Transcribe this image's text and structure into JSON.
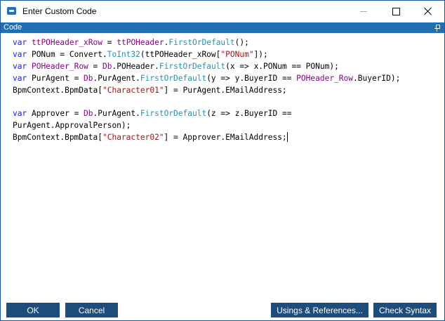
{
  "window": {
    "title": "Enter Custom Code",
    "icon": "app-icon"
  },
  "panel": {
    "title": "Code",
    "pin_icon": "pin-icon"
  },
  "code": {
    "lines": [
      [
        [
          "kw",
          "var"
        ],
        [
          "pl",
          " "
        ],
        [
          "var",
          "ttPOHeader_xRow"
        ],
        [
          "pl",
          " = "
        ],
        [
          "var",
          "ttPOHeader"
        ],
        [
          "pl",
          "."
        ],
        [
          "ty",
          "FirstOrDefault"
        ],
        [
          "pl",
          "();"
        ]
      ],
      [
        [
          "kw",
          "var"
        ],
        [
          "pl",
          " PONum = Convert."
        ],
        [
          "ty",
          "ToInt32"
        ],
        [
          "pl",
          "(ttPOHeader_xRow["
        ],
        [
          "str",
          "\"PONum\""
        ],
        [
          "pl",
          "]);"
        ]
      ],
      [
        [
          "kw",
          "var"
        ],
        [
          "pl",
          " "
        ],
        [
          "var",
          "POHeader_Row"
        ],
        [
          "pl",
          " = "
        ],
        [
          "var",
          "Db"
        ],
        [
          "pl",
          ".POHeader."
        ],
        [
          "ty",
          "FirstOrDefault"
        ],
        [
          "pl",
          "(x => x.PONum == PONum);"
        ]
      ],
      [
        [
          "kw",
          "var"
        ],
        [
          "pl",
          " PurAgent = "
        ],
        [
          "var",
          "Db"
        ],
        [
          "pl",
          ".PurAgent."
        ],
        [
          "ty",
          "FirstOrDefault"
        ],
        [
          "pl",
          "(y => y.BuyerID == "
        ],
        [
          "var",
          "POHeader_Row"
        ],
        [
          "pl",
          ".BuyerID);"
        ]
      ],
      [
        [
          "pl",
          "BpmContext.BpmData["
        ],
        [
          "str",
          "\"Character01\""
        ],
        [
          "pl",
          "] = PurAgent.EMailAddress;"
        ]
      ],
      [],
      [
        [
          "kw",
          "var"
        ],
        [
          "pl",
          " Approver = "
        ],
        [
          "var",
          "Db"
        ],
        [
          "pl",
          ".PurAgent."
        ],
        [
          "ty",
          "FirstOrDefault"
        ],
        [
          "pl",
          "(z => z.BuyerID =="
        ]
      ],
      [
        [
          "pl",
          "PurAgent.ApprovalPerson);"
        ]
      ],
      [
        [
          "pl",
          "BpmContext.BpmData["
        ],
        [
          "str",
          "\"Character02\""
        ],
        [
          "pl",
          "] = Approver.EMailAddress;"
        ]
      ]
    ]
  },
  "buttons": {
    "ok": "OK",
    "cancel": "Cancel",
    "usings": "Usings & References...",
    "check": "Check Syntax"
  },
  "colors": {
    "accent": "#1f6fb2",
    "button": "#1e4d7b",
    "keyword": "#1a1aff",
    "identifier": "#8b008b",
    "method": "#2b91af",
    "string": "#a31515"
  }
}
